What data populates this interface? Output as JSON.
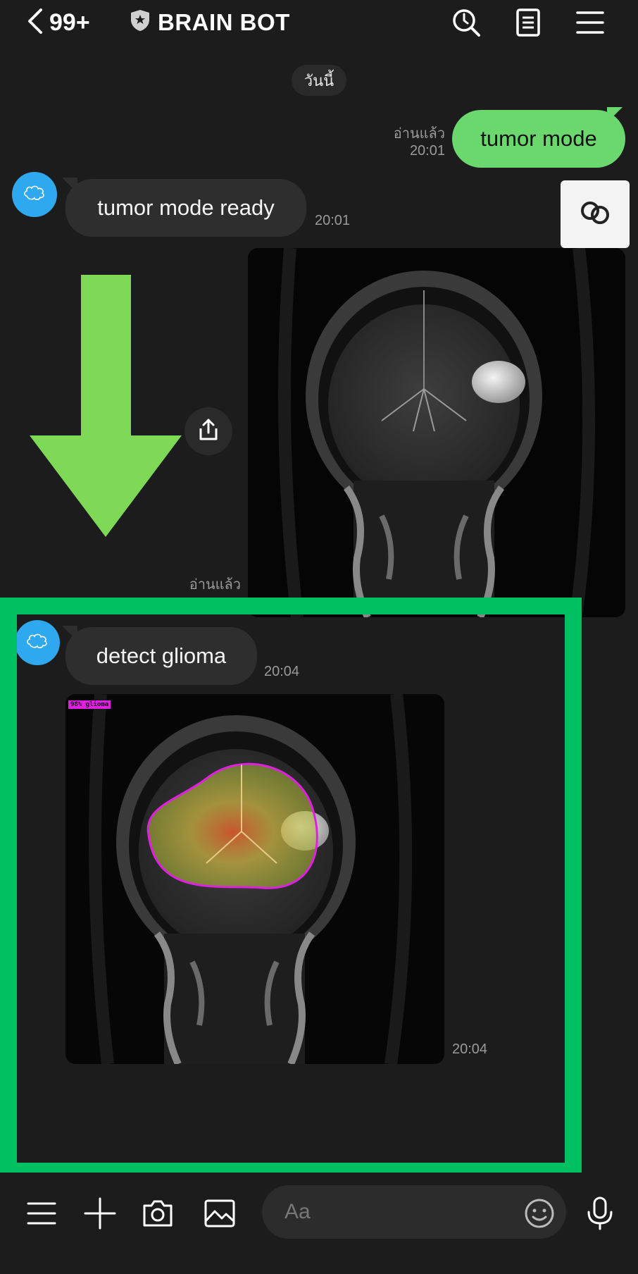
{
  "header": {
    "back_count": "99+",
    "title": "BRAIN BOT",
    "icons": [
      "chevron-left-icon",
      "shield-badge-icon",
      "search-icon",
      "notes-icon",
      "menu-icon"
    ]
  },
  "chat": {
    "date_label": "วันนี้",
    "messages": [
      {
        "side": "out",
        "text": "tumor mode",
        "read": "อ่านแล้ว",
        "time": "20:01"
      },
      {
        "side": "in",
        "text": "tumor mode ready",
        "time": "20:01"
      },
      {
        "side": "out",
        "type": "image",
        "read": "อ่านแล้ว"
      },
      {
        "side": "in",
        "text": "detect glioma",
        "time": "20:04"
      },
      {
        "side": "in",
        "type": "image",
        "overlay_label": "98% glioma",
        "time": "20:04"
      }
    ]
  },
  "annotation": {
    "arrow_color": "#7ed957",
    "box_color": "#00c162"
  },
  "composer": {
    "placeholder": "Aa",
    "icons": [
      "menu-icon",
      "plus-icon",
      "camera-icon",
      "image-icon",
      "emoji-icon",
      "microphone-icon"
    ]
  },
  "colors": {
    "background": "#1c1c1c",
    "outgoing_bubble": "#6bd86e",
    "incoming_bubble": "#2e2e2e",
    "avatar": "#2ea8ef"
  }
}
